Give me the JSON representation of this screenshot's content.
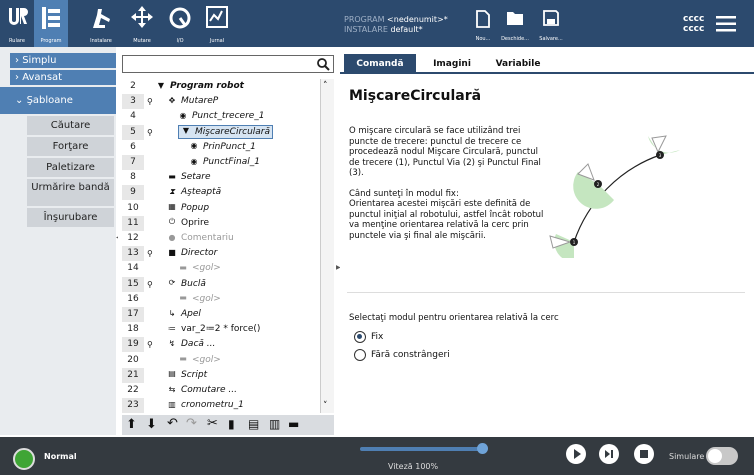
{
  "topbar": {
    "logo_label": "Rulare",
    "program_label": "Program",
    "install_label": "Instalare",
    "move_label": "Mutare",
    "io_label": "I/O",
    "log_label": "Jurnal",
    "program_prefix": "PROGRAM",
    "program_name": "<nedenumit>*",
    "install_prefix": "INSTALARE",
    "install_name": "default*",
    "new_label": "Nou...",
    "open_label": "Deschide...",
    "save_label": "Salvare...",
    "user_line1": "cccc",
    "user_line2": "cccc"
  },
  "sidebar": {
    "items": [
      {
        "label": "Simplu",
        "arrow": "›"
      },
      {
        "label": "Avansat",
        "arrow": "›"
      },
      {
        "label": "Şabloane",
        "arrow": "⌄"
      }
    ],
    "subitems": [
      "Căutare",
      "Forţare",
      "Paletizare",
      "Urmărire bandă",
      "Înşurubare"
    ]
  },
  "tree": {
    "rows": [
      {
        "n": "2",
        "label": "Program robot",
        "icon": "▼",
        "bold": true,
        "italic": true,
        "indent": 0
      },
      {
        "n": "3",
        "label": "MutareP",
        "icon": "✥",
        "italic": true,
        "indent": 1,
        "mark": "⚲"
      },
      {
        "n": "4",
        "label": "Punct_trecere_1",
        "icon": "◉",
        "italic": true,
        "indent": 2
      },
      {
        "n": "5",
        "label": "MişcareCirculară",
        "icon": "▼",
        "italic": true,
        "indent": 2,
        "mark": "⚲",
        "selected": true
      },
      {
        "n": "6",
        "label": "PrinPunct_1",
        "icon": "◉",
        "italic": true,
        "indent": 3
      },
      {
        "n": "7",
        "label": "PunctFinal_1",
        "icon": "◉",
        "italic": true,
        "indent": 3
      },
      {
        "n": "8",
        "label": "Setare",
        "icon": "▬",
        "italic": true,
        "indent": 1
      },
      {
        "n": "9",
        "label": "Aşteaptă",
        "icon": "⧗",
        "italic": true,
        "indent": 1
      },
      {
        "n": "10",
        "label": "Popup",
        "icon": "▦",
        "italic": true,
        "indent": 1
      },
      {
        "n": "11",
        "label": "Oprire",
        "icon": "⏻",
        "indent": 1
      },
      {
        "n": "12",
        "label": "Comentariu",
        "icon": "●",
        "gray": true,
        "indent": 1
      },
      {
        "n": "13",
        "label": "Director",
        "icon": "■",
        "italic": true,
        "indent": 1,
        "mark": "⚲"
      },
      {
        "n": "14",
        "label": "<gol>",
        "icon": "▬",
        "italic": true,
        "gray": true,
        "indent": 2
      },
      {
        "n": "15",
        "label": "Buclă",
        "icon": "⟳",
        "italic": true,
        "indent": 1,
        "mark": "⚲"
      },
      {
        "n": "16",
        "label": "<gol>",
        "icon": "▬",
        "italic": true,
        "gray": true,
        "indent": 2
      },
      {
        "n": "17",
        "label": "Apel",
        "icon": "↳",
        "italic": true,
        "indent": 1
      },
      {
        "n": "18",
        "label": "var_2≔2 * force()",
        "icon": "≔",
        "indent": 1
      },
      {
        "n": "19",
        "label": "Dacă ...",
        "icon": "↯",
        "italic": true,
        "indent": 1,
        "mark": "⚲"
      },
      {
        "n": "20",
        "label": "<gol>",
        "icon": "▬",
        "italic": true,
        "gray": true,
        "indent": 2
      },
      {
        "n": "21",
        "label": "Script",
        "icon": "▤",
        "italic": true,
        "indent": 1
      },
      {
        "n": "22",
        "label": "Comutare ...",
        "icon": "⇆",
        "italic": true,
        "indent": 1
      },
      {
        "n": "23",
        "label": "cronometru_1",
        "icon": "▥",
        "italic": true,
        "indent": 1
      }
    ]
  },
  "tabs": [
    "Comandă",
    "Imagini",
    "Variabile"
  ],
  "panel": {
    "title": "MişcareCirculară",
    "desc1": "O mişcare circulară se face utilizând trei puncte de trecere: punctul de trecere ce procedează nodul Mişcare Circulară, punctul de trecere (1), Punctul Via (2) şi Punctul Final (3).",
    "desc2": "Când sunteţi în modul fix:",
    "desc3": "Orientarea acestei mişcări este definită de punctul iniţial al robotului, astfel încât robotul va menţine orientarea relativă la cerc prin punctele via şi final ale mişcării.",
    "orient_label": "Selectaţi modul pentru orientarea relativă la cerc",
    "option_fixed": "Fix",
    "option_free": "Fără constrângeri",
    "diagram_points": [
      "1",
      "2",
      "3"
    ]
  },
  "footer": {
    "status": "Normal",
    "speed": "Viteză 100%",
    "speed_value": 100,
    "simulation_label": "Simulare"
  },
  "colors": {
    "header": "#2c4a6e",
    "accent": "#4f7fb3",
    "status_ok": "#3fa535",
    "footer": "#343a40",
    "diagram_green": "#c5e6c0"
  }
}
